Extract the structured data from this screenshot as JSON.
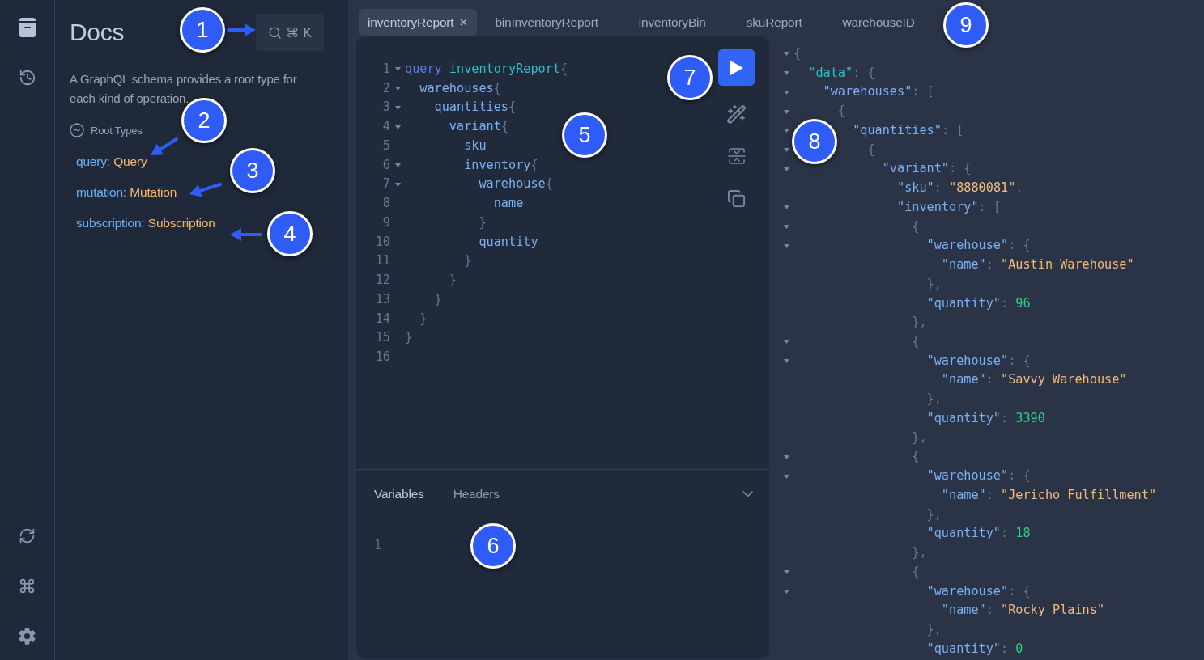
{
  "rail": {
    "top": [
      {
        "kind": "docs",
        "selected": true
      },
      {
        "kind": "history",
        "selected": false
      }
    ],
    "bottom": [
      {
        "kind": "refresh"
      },
      {
        "kind": "shortcuts"
      },
      {
        "kind": "settings"
      }
    ]
  },
  "docs": {
    "title": "Docs",
    "search_shortcut": "⌘ K",
    "description": "A GraphQL schema provides a root type for each kind of operation.",
    "section": "Root Types",
    "root_types": [
      {
        "field": "query",
        "separator": ":",
        "type": "Query"
      },
      {
        "field": "mutation",
        "separator": ":",
        "type": "Mutation"
      },
      {
        "field": "subscription",
        "separator": ":",
        "type": "Subscription"
      }
    ]
  },
  "tabs": [
    {
      "label": "inventoryReport",
      "selected": true,
      "closable": true
    },
    {
      "label": "binInventoryReport",
      "selected": false,
      "closable": false
    },
    {
      "label": "inventoryBin",
      "selected": false,
      "closable": false
    },
    {
      "label": "skuReport",
      "selected": false,
      "closable": false
    },
    {
      "label": "warehouseID",
      "selected": false,
      "closable": false
    }
  ],
  "editor": {
    "lines": [
      {
        "number": "1",
        "foldable": true,
        "tokens": [
          {
            "kind": "keyword",
            "text": "query"
          },
          {
            "kind": "def",
            "text": "inventoryReport"
          },
          {
            "kind": "open",
            "text": "{"
          }
        ]
      },
      {
        "number": "2",
        "foldable": true,
        "tokens": [
          {
            "kind": "field",
            "text": "warehouses"
          },
          {
            "kind": "open",
            "text": "{"
          }
        ]
      },
      {
        "number": "3",
        "foldable": true,
        "tokens": [
          {
            "kind": "field",
            "text": "quantities"
          },
          {
            "kind": "open",
            "text": "{"
          }
        ]
      },
      {
        "number": "4",
        "foldable": true,
        "tokens": [
          {
            "kind": "field",
            "text": "variant"
          },
          {
            "kind": "open",
            "text": "{"
          }
        ]
      },
      {
        "number": "5",
        "foldable": false,
        "tokens": [
          {
            "kind": "field",
            "text": "sku"
          }
        ]
      },
      {
        "number": "6",
        "foldable": true,
        "tokens": [
          {
            "kind": "field",
            "text": "inventory"
          },
          {
            "kind": "open",
            "text": "{"
          }
        ]
      },
      {
        "number": "7",
        "foldable": true,
        "tokens": [
          {
            "kind": "field",
            "text": "warehouse"
          },
          {
            "kind": "open",
            "text": "{"
          }
        ]
      },
      {
        "number": "8",
        "foldable": false,
        "tokens": [
          {
            "kind": "field",
            "text": "name"
          }
        ]
      },
      {
        "number": "9",
        "foldable": false,
        "tokens": [
          {
            "kind": "close",
            "text": "}"
          }
        ]
      },
      {
        "number": "10",
        "foldable": false,
        "tokens": [
          {
            "kind": "field",
            "text": "quantity"
          }
        ]
      },
      {
        "number": "11",
        "foldable": false,
        "tokens": [
          {
            "kind": "close",
            "text": "}"
          }
        ]
      },
      {
        "number": "12",
        "foldable": false,
        "tokens": [
          {
            "kind": "close",
            "text": "}"
          }
        ]
      },
      {
        "number": "13",
        "foldable": false,
        "tokens": [
          {
            "kind": "close",
            "text": "}"
          }
        ]
      },
      {
        "number": "14",
        "foldable": false,
        "tokens": [
          {
            "kind": "close",
            "text": "}"
          }
        ]
      },
      {
        "number": "15",
        "foldable": false,
        "tokens": [
          {
            "kind": "close",
            "text": "}"
          }
        ]
      },
      {
        "number": "16",
        "foldable": false
      }
    ],
    "bottom_tabs": [
      {
        "label": "Variables",
        "selected": true
      },
      {
        "label": "Headers",
        "selected": false
      }
    ],
    "variables_lines": [
      {
        "number": "1"
      }
    ]
  },
  "result": {
    "lines": [
      {
        "foldable": true,
        "tokens": [
          {
            "kind": "open",
            "text": "{"
          }
        ]
      },
      {
        "foldable": true,
        "tokens": [
          {
            "kind": "toplevel",
            "text": "\"data\""
          },
          {
            "kind": "punct",
            "text": ":"
          },
          {
            "kind": "open",
            "text": "{"
          }
        ]
      },
      {
        "foldable": true,
        "tokens": [
          {
            "kind": "key",
            "text": "\"warehouses\""
          },
          {
            "kind": "punct",
            "text": ":"
          },
          {
            "kind": "open",
            "text": "["
          }
        ]
      },
      {
        "foldable": true,
        "tokens": [
          {
            "kind": "open",
            "text": "{"
          }
        ]
      },
      {
        "foldable": true,
        "tokens": [
          {
            "kind": "key",
            "text": "\"quantities\""
          },
          {
            "kind": "punct",
            "text": ":"
          },
          {
            "kind": "open",
            "text": "["
          }
        ]
      },
      {
        "foldable": true,
        "tokens": [
          {
            "kind": "open",
            "text": "{"
          }
        ]
      },
      {
        "foldable": true,
        "tokens": [
          {
            "kind": "key",
            "text": "\"variant\""
          },
          {
            "kind": "punct",
            "text": ":"
          },
          {
            "kind": "open",
            "text": "{"
          }
        ]
      },
      {
        "foldable": false,
        "tokens": [
          {
            "kind": "key",
            "text": "\"sku\""
          },
          {
            "kind": "punct",
            "text": ":"
          },
          {
            "kind": "string",
            "text": "\"8880081\""
          },
          {
            "kind": "comma",
            "text": ","
          }
        ]
      },
      {
        "foldable": true,
        "tokens": [
          {
            "kind": "key",
            "text": "\"inventory\""
          },
          {
            "kind": "punct",
            "text": ":"
          },
          {
            "kind": "open",
            "text": "["
          }
        ]
      },
      {
        "foldable": true,
        "tokens": [
          {
            "kind": "open",
            "text": "{"
          }
        ]
      },
      {
        "foldable": true,
        "tokens": [
          {
            "kind": "key",
            "text": "\"warehouse\""
          },
          {
            "kind": "punct",
            "text": ":"
          },
          {
            "kind": "open",
            "text": "{"
          }
        ]
      },
      {
        "foldable": false,
        "tokens": [
          {
            "kind": "key",
            "text": "\"name\""
          },
          {
            "kind": "punct",
            "text": ":"
          },
          {
            "kind": "string",
            "text": "\"Austin Warehouse\""
          }
        ]
      },
      {
        "foldable": false,
        "tokens": [
          {
            "kind": "close",
            "text": "},"
          }
        ]
      },
      {
        "foldable": false,
        "tokens": [
          {
            "kind": "key",
            "text": "\"quantity\""
          },
          {
            "kind": "punct",
            "text": ":"
          },
          {
            "kind": "number",
            "text": "96"
          }
        ]
      },
      {
        "foldable": false,
        "tokens": [
          {
            "kind": "close",
            "text": "},"
          }
        ]
      },
      {
        "foldable": true,
        "tokens": [
          {
            "kind": "open",
            "text": "{"
          }
        ]
      },
      {
        "foldable": true,
        "tokens": [
          {
            "kind": "key",
            "text": "\"warehouse\""
          },
          {
            "kind": "punct",
            "text": ":"
          },
          {
            "kind": "open",
            "text": "{"
          }
        ]
      },
      {
        "foldable": false,
        "tokens": [
          {
            "kind": "key",
            "text": "\"name\""
          },
          {
            "kind": "punct",
            "text": ":"
          },
          {
            "kind": "string",
            "text": "\"Savvy Warehouse\""
          }
        ]
      },
      {
        "foldable": false,
        "tokens": [
          {
            "kind": "close",
            "text": "},"
          }
        ]
      },
      {
        "foldable": false,
        "tokens": [
          {
            "kind": "key",
            "text": "\"quantity\""
          },
          {
            "kind": "punct",
            "text": ":"
          },
          {
            "kind": "number",
            "text": "3390"
          }
        ]
      },
      {
        "foldable": false,
        "tokens": [
          {
            "kind": "close",
            "text": "},"
          }
        ]
      },
      {
        "foldable": true,
        "tokens": [
          {
            "kind": "open",
            "text": "{"
          }
        ]
      },
      {
        "foldable": true,
        "tokens": [
          {
            "kind": "key",
            "text": "\"warehouse\""
          },
          {
            "kind": "punct",
            "text": ":"
          },
          {
            "kind": "open",
            "text": "{"
          }
        ]
      },
      {
        "foldable": false,
        "tokens": [
          {
            "kind": "key",
            "text": "\"name\""
          },
          {
            "kind": "punct",
            "text": ":"
          },
          {
            "kind": "string",
            "text": "\"Jericho Fulfillment\""
          }
        ]
      },
      {
        "foldable": false,
        "tokens": [
          {
            "kind": "close",
            "text": "},"
          }
        ]
      },
      {
        "foldable": false,
        "tokens": [
          {
            "kind": "key",
            "text": "\"quantity\""
          },
          {
            "kind": "punct",
            "text": ":"
          },
          {
            "kind": "number",
            "text": "18"
          }
        ]
      },
      {
        "foldable": false,
        "tokens": [
          {
            "kind": "close",
            "text": "},"
          }
        ]
      },
      {
        "foldable": true,
        "tokens": [
          {
            "kind": "open",
            "text": "{"
          }
        ]
      },
      {
        "foldable": true,
        "tokens": [
          {
            "kind": "key",
            "text": "\"warehouse\""
          },
          {
            "kind": "punct",
            "text": ":"
          },
          {
            "kind": "open",
            "text": "{"
          }
        ]
      },
      {
        "foldable": false,
        "tokens": [
          {
            "kind": "key",
            "text": "\"name\""
          },
          {
            "kind": "punct",
            "text": ":"
          },
          {
            "kind": "string",
            "text": "\"Rocky Plains\""
          }
        ]
      },
      {
        "foldable": false,
        "tokens": [
          {
            "kind": "close",
            "text": "},"
          }
        ]
      },
      {
        "foldable": false,
        "tokens": [
          {
            "kind": "key",
            "text": "\"quantity\""
          },
          {
            "kind": "punct",
            "text": ":"
          },
          {
            "kind": "number",
            "text": "0"
          }
        ]
      }
    ]
  },
  "callouts": [
    {
      "label": "1"
    },
    {
      "label": "2"
    },
    {
      "label": "3"
    },
    {
      "label": "4"
    },
    {
      "label": "5"
    },
    {
      "label": "6"
    },
    {
      "label": "7"
    },
    {
      "label": "8"
    },
    {
      "label": "9"
    }
  ]
}
